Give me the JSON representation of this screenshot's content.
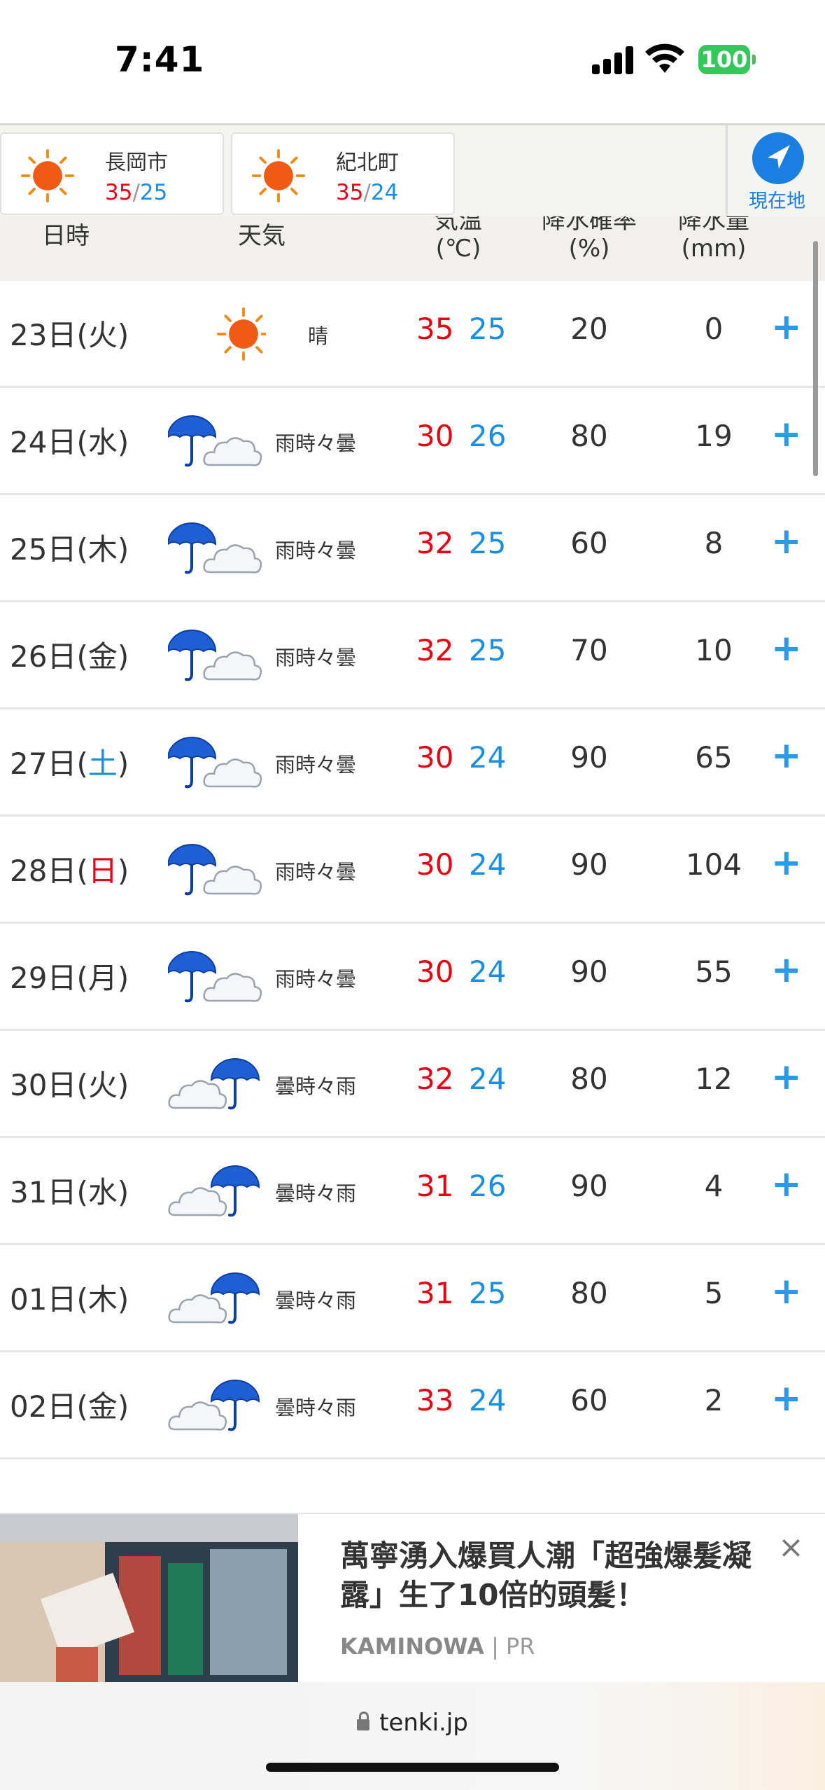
{
  "status_bar": {
    "time": "7:41",
    "battery": "100"
  },
  "locations": [
    {
      "name": "長岡市",
      "high": "35",
      "low": "25"
    },
    {
      "name": "紀北町",
      "high": "35",
      "low": "24"
    }
  ],
  "current_location_label": "現在地",
  "columns": {
    "date": "日時",
    "weather": "天気",
    "temp_line1": "気温",
    "temp_line2": "(℃)",
    "prob_line1": "降水確率",
    "prob_line2": "(%)",
    "amount_line1": "降水量",
    "amount_line2": "(mm)"
  },
  "forecast": [
    {
      "day": "23日",
      "open": "(",
      "weekday": "火",
      "close": ")",
      "weekday_color": "normal",
      "icon": "sunny-icon",
      "weather": "晴",
      "high": "35",
      "low": "25",
      "prob": "20",
      "amount": "0"
    },
    {
      "day": "24日",
      "open": "(",
      "weekday": "水",
      "close": ")",
      "weekday_color": "normal",
      "icon": "rain-then-cloud-icon",
      "weather": "雨時々曇",
      "high": "30",
      "low": "26",
      "prob": "80",
      "amount": "19"
    },
    {
      "day": "25日",
      "open": "(",
      "weekday": "木",
      "close": ")",
      "weekday_color": "normal",
      "icon": "rain-then-cloud-icon",
      "weather": "雨時々曇",
      "high": "32",
      "low": "25",
      "prob": "60",
      "amount": "8"
    },
    {
      "day": "26日",
      "open": "(",
      "weekday": "金",
      "close": ")",
      "weekday_color": "normal",
      "icon": "rain-then-cloud-icon",
      "weather": "雨時々曇",
      "high": "32",
      "low": "25",
      "prob": "70",
      "amount": "10"
    },
    {
      "day": "27日",
      "open": "(",
      "weekday": "土",
      "close": ")",
      "weekday_color": "blue",
      "icon": "rain-then-cloud-icon",
      "weather": "雨時々曇",
      "high": "30",
      "low": "24",
      "prob": "90",
      "amount": "65"
    },
    {
      "day": "28日",
      "open": "(",
      "weekday": "日",
      "close": ")",
      "weekday_color": "red",
      "icon": "rain-then-cloud-icon",
      "weather": "雨時々曇",
      "high": "30",
      "low": "24",
      "prob": "90",
      "amount": "104"
    },
    {
      "day": "29日",
      "open": "(",
      "weekday": "月",
      "close": ")",
      "weekday_color": "normal",
      "icon": "rain-then-cloud-icon",
      "weather": "雨時々曇",
      "high": "30",
      "low": "24",
      "prob": "90",
      "amount": "55"
    },
    {
      "day": "30日",
      "open": "(",
      "weekday": "火",
      "close": ")",
      "weekday_color": "normal",
      "icon": "cloud-then-rain-icon",
      "weather": "曇時々雨",
      "high": "32",
      "low": "24",
      "prob": "80",
      "amount": "12"
    },
    {
      "day": "31日",
      "open": "(",
      "weekday": "水",
      "close": ")",
      "weekday_color": "normal",
      "icon": "cloud-then-rain-icon",
      "weather": "曇時々雨",
      "high": "31",
      "low": "26",
      "prob": "90",
      "amount": "4"
    },
    {
      "day": "01日",
      "open": "(",
      "weekday": "木",
      "close": ")",
      "weekday_color": "normal",
      "icon": "cloud-then-rain-icon",
      "weather": "曇時々雨",
      "high": "31",
      "low": "25",
      "prob": "80",
      "amount": "5"
    },
    {
      "day": "02日",
      "open": "(",
      "weekday": "金",
      "close": ")",
      "weekday_color": "normal",
      "icon": "cloud-then-rain-icon",
      "weather": "曇時々雨",
      "high": "33",
      "low": "24",
      "prob": "60",
      "amount": "2"
    }
  ],
  "expand_label": "+",
  "ad": {
    "title": "萬寧湧入爆買人潮「超強爆髮凝露」生了10倍的頭髮！",
    "source": "KAMINOWA",
    "divider": "|",
    "pr": "PR",
    "close": "×"
  },
  "browser": {
    "url": "tenki.jp"
  },
  "colors": {
    "high": "#e60012",
    "low": "#1a8fe0",
    "accent": "#1a7fe0",
    "plus": "#2a9be8"
  }
}
